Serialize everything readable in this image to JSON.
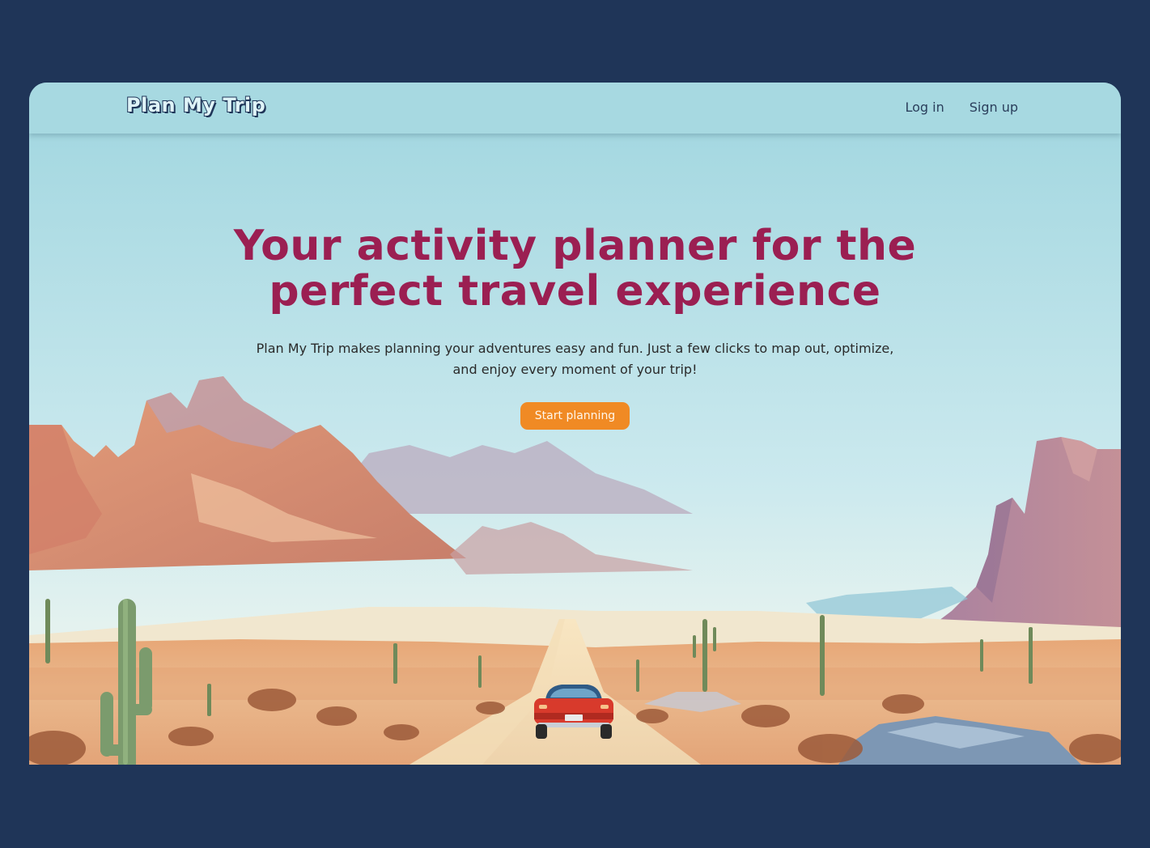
{
  "nav": {
    "logo": "Plan My Trip",
    "login": "Log in",
    "signup": "Sign up"
  },
  "hero": {
    "headline_line1": "Your activity planner for the",
    "headline_line2": "perfect travel experience",
    "description_line1": "Plan My Trip makes planning your adventures easy and fun. Just a few clicks to map out, optimize,",
    "description_line2": "and enjoy every moment of your trip!",
    "cta": "Start planning"
  },
  "colors": {
    "page_background": "#1f3558",
    "navbar": "#a7d9e1",
    "headline": "#9b1f52",
    "cta": "#f08a24",
    "car_body": "#d83a2c"
  }
}
